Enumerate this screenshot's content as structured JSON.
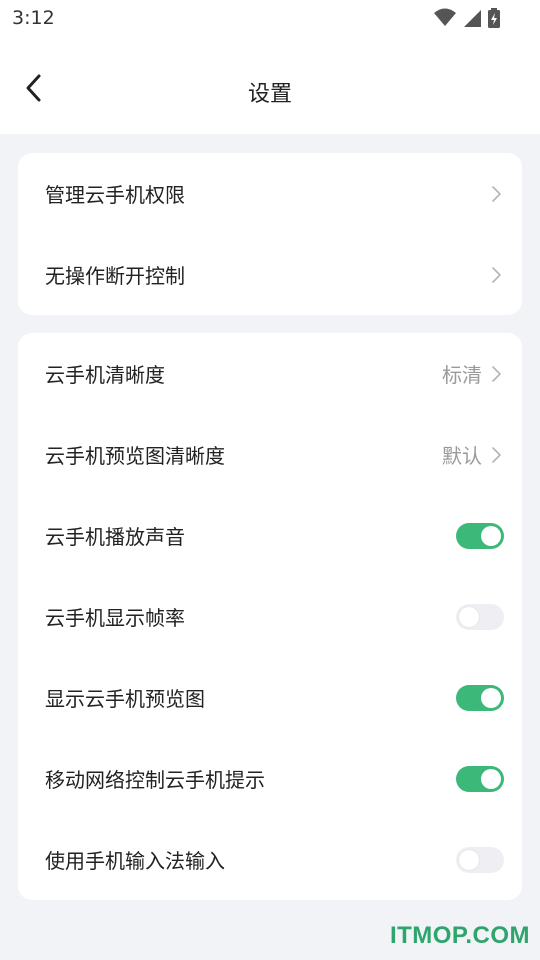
{
  "status_bar": {
    "time": "3:12",
    "icons": [
      "wifi-icon",
      "signal-icon",
      "battery-charging-icon"
    ]
  },
  "header": {
    "title": "设置",
    "back_icon": "chevron-left-icon"
  },
  "group1": [
    {
      "label": "管理云手机权限",
      "type": "link"
    },
    {
      "label": "无操作断开控制",
      "type": "link"
    }
  ],
  "group2": [
    {
      "label": "云手机清晰度",
      "type": "select",
      "value": "标清"
    },
    {
      "label": "云手机预览图清晰度",
      "type": "select",
      "value": "默认"
    },
    {
      "label": "云手机播放声音",
      "type": "toggle",
      "checked": true
    },
    {
      "label": "云手机显示帧率",
      "type": "toggle",
      "checked": false
    },
    {
      "label": "显示云手机预览图",
      "type": "toggle",
      "checked": true
    },
    {
      "label": "移动网络控制云手机提示",
      "type": "toggle",
      "checked": true
    },
    {
      "label": "使用手机输入法输入",
      "type": "toggle",
      "checked": false
    }
  ],
  "watermark": "ITMOP.COM",
  "colors": {
    "accent_green": "#3cb878",
    "background": "#f2f3f6",
    "card": "#ffffff",
    "secondary_text": "#9a9a9a"
  }
}
